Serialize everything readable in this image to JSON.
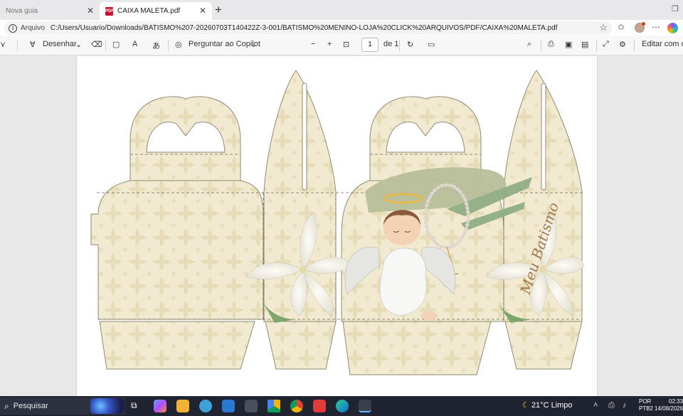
{
  "tabs": [
    {
      "label": "Nova guia",
      "active": false
    },
    {
      "label": "CAIXA MALETA.pdf",
      "active": true
    }
  ],
  "address_bar": {
    "chip": "Arquivo",
    "url": "C:/Users/Usuario/Downloads/BATISMO%207-20260703T140422Z-3-001/BATISMO%20MENINO-LOJA%20CLICK%20ARQUIVOS/PDF/CAIXA%20MALETA.pdf"
  },
  "pdf_toolbar": {
    "draw_label": "Desenhar",
    "copilot_label": "Perguntar ao Copilot",
    "page_current": "1",
    "page_total": "de 1",
    "edit_label": "Editar com o A"
  },
  "document": {
    "title_script": "Meu Batismo"
  },
  "taskbar": {
    "search_label": "Pesquisar",
    "weather": "21°C  Limpo",
    "lang_line1": "POR",
    "lang_line2": "PTB2",
    "time": "02:33",
    "date": "14/08/2026"
  },
  "colors": {
    "panel_fill": "#f2ead0",
    "panel_pattern": "#e7dcb8",
    "panel_stroke": "#8f8a76",
    "accent_green": "#8fae86",
    "pdf_red": "#c8102e"
  }
}
